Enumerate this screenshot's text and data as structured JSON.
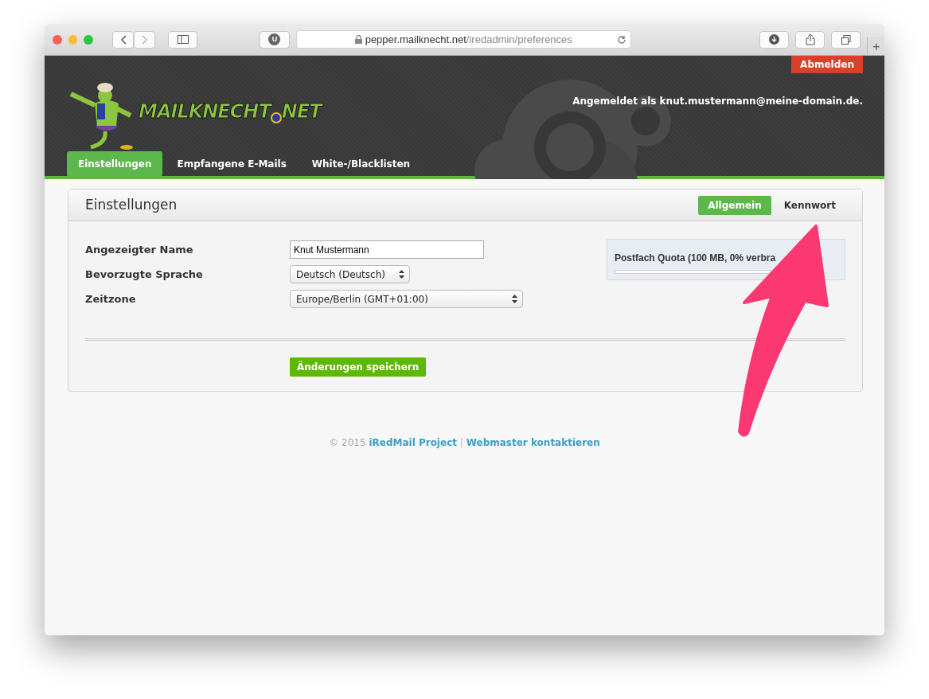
{
  "browser": {
    "extension_label": "U",
    "url_host": "pepper.mailknecht.net",
    "url_path": "/iredadmin/preferences",
    "new_tab": "+"
  },
  "header": {
    "logout": "Abmelden",
    "logo_text": "MAILKNECHT",
    "logo_suffix": "NET",
    "login_info": "Angemeldet als knut.mustermann@meine-domain.de.",
    "nav": [
      {
        "label": "Einstellungen",
        "selected": true
      },
      {
        "label": "Empfangene E-Mails",
        "selected": false
      },
      {
        "label": "White-/Blacklisten",
        "selected": false
      }
    ]
  },
  "panel": {
    "title": "Einstellungen",
    "tabs": [
      {
        "label": "Allgemein",
        "selected": true
      },
      {
        "label": "Kennwort",
        "selected": false
      }
    ],
    "fields": [
      {
        "kind": "input",
        "label": "Angezeigter Name",
        "value": "Knut Mustermann"
      },
      {
        "kind": "select",
        "label": "Bevorzugte Sprache",
        "value": "Deutsch (Deutsch)"
      },
      {
        "kind": "select",
        "label": "Zeitzone",
        "value": "Europe/Berlin (GMT+01:00)"
      }
    ],
    "quota": {
      "title": "Postfach Quota (100 MB, 0% verbra",
      "level": 0
    },
    "save": "Änderungen speichern"
  },
  "footer": {
    "copyright": "© 2015",
    "project_link": "iRedMail Project",
    "separator": "|",
    "contact_link": "Webmaster kontaktieren"
  }
}
